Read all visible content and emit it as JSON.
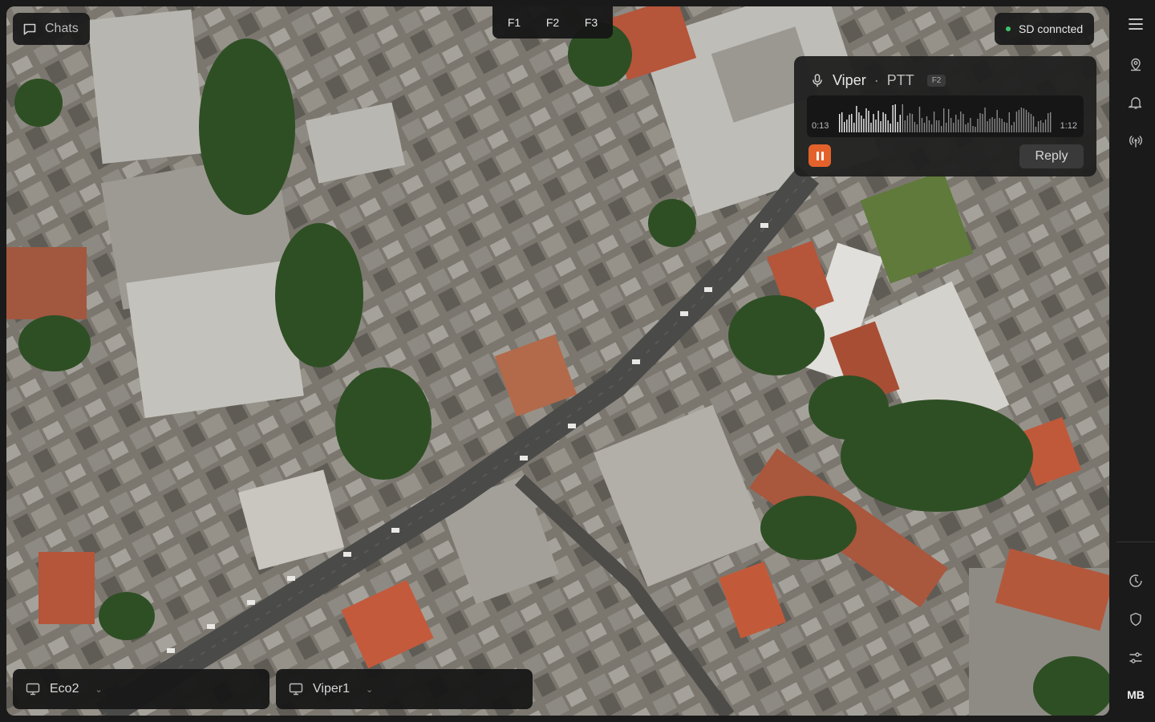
{
  "top_left": {
    "chats_label": "Chats"
  },
  "function_keys": [
    "F1",
    "F2",
    "F3"
  ],
  "status": {
    "label": "SD conncted",
    "color": "#3ec46d"
  },
  "voice_message": {
    "sender": "Viper",
    "separator": "·",
    "mode": "PTT",
    "key_badge": "F2",
    "elapsed": "0:13",
    "duration": "1:12",
    "progress": 0.18,
    "reply_label": "Reply",
    "accent": "#e3622b"
  },
  "bottom_panels": [
    {
      "label": "Eco2",
      "icon": "monitor-icon"
    },
    {
      "label": "Viper1",
      "icon": "monitor-icon"
    }
  ],
  "right_rail": {
    "top_items": [
      "menu-icon",
      "location-pin-icon",
      "bell-icon",
      "broadcast-icon"
    ],
    "bottom_items": [
      "history-icon",
      "shield-icon",
      "sliders-icon"
    ],
    "user_initials": "MB"
  }
}
